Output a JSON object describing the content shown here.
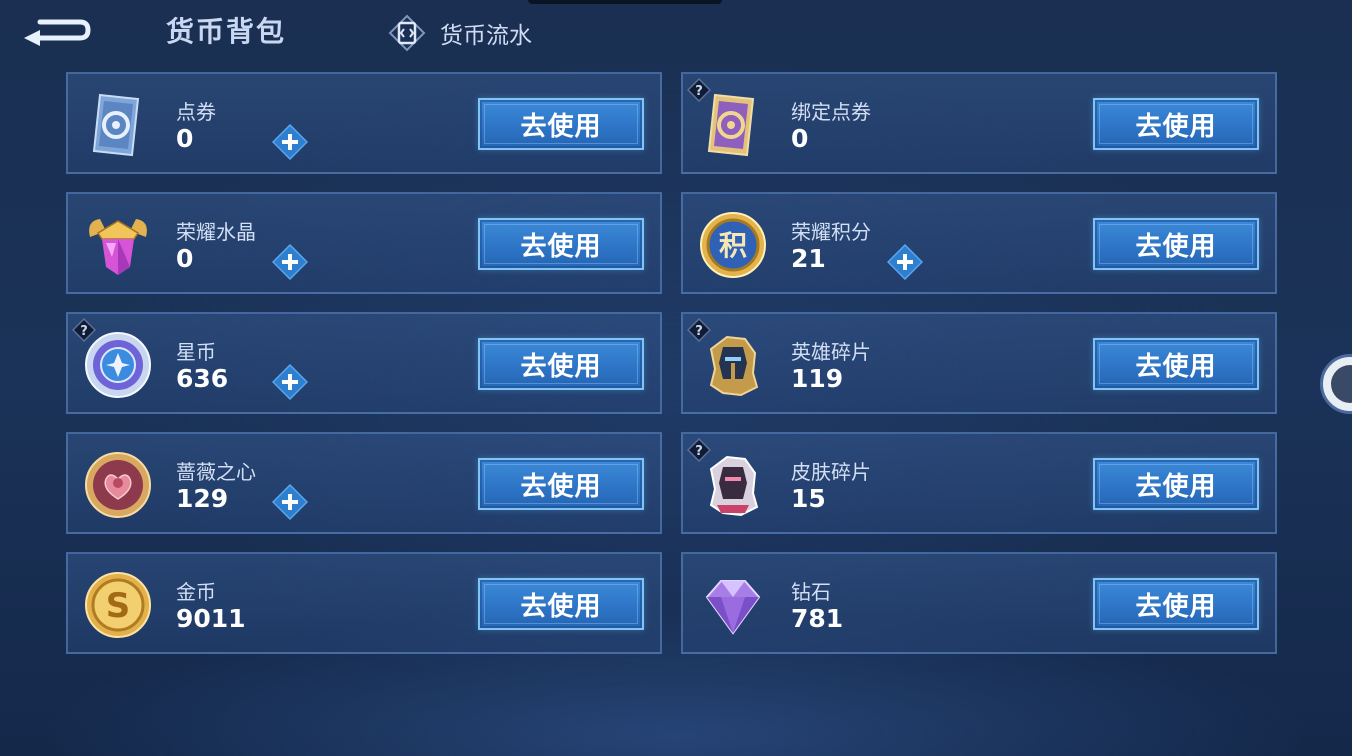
{
  "header": {
    "title": "货币背包",
    "flow_tab": "货币流水"
  },
  "colors": {
    "button_fill": "#2f78c9",
    "button_border": "#7fc4f2",
    "card_fill": "#2c4e84",
    "plus_color": "#2f7fd0"
  },
  "currencies": [
    {
      "name": "点券",
      "value": "0",
      "icon": "voucher-icon",
      "button": "去使用",
      "has_plus": true,
      "has_help": false
    },
    {
      "name": "绑定点券",
      "value": "0",
      "icon": "bound-voucher-icon",
      "button": "去使用",
      "has_plus": false,
      "has_help": true
    },
    {
      "name": "荣耀水晶",
      "value": "0",
      "icon": "glory-crystal-icon",
      "button": "去使用",
      "has_plus": true,
      "has_help": false
    },
    {
      "name": "荣耀积分",
      "value": "21",
      "icon": "glory-points-icon",
      "button": "去使用",
      "has_plus": true,
      "has_help": false
    },
    {
      "name": "星币",
      "value": "636",
      "icon": "star-coin-icon",
      "button": "去使用",
      "has_plus": true,
      "has_help": true
    },
    {
      "name": "英雄碎片",
      "value": "119",
      "icon": "hero-fragment-icon",
      "button": "去使用",
      "has_plus": false,
      "has_help": true
    },
    {
      "name": "蔷薇之心",
      "value": "129",
      "icon": "rose-heart-icon",
      "button": "去使用",
      "has_plus": true,
      "has_help": false
    },
    {
      "name": "皮肤碎片",
      "value": "15",
      "icon": "skin-fragment-icon",
      "button": "去使用",
      "has_plus": false,
      "has_help": true
    },
    {
      "name": "金币",
      "value": "9011",
      "icon": "gold-coin-icon",
      "button": "去使用",
      "has_plus": false,
      "has_help": false
    },
    {
      "name": "钻石",
      "value": "781",
      "icon": "diamond-icon",
      "button": "去使用",
      "has_plus": false,
      "has_help": false
    }
  ]
}
